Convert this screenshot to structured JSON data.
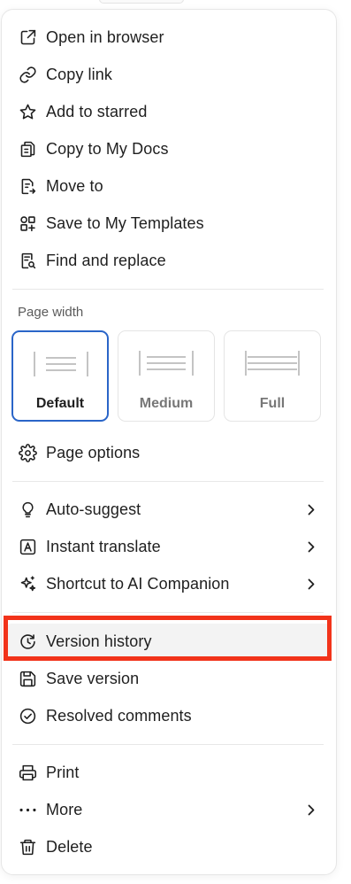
{
  "menu": {
    "group1": [
      {
        "label": "Open in browser",
        "icon": "external-link-icon"
      },
      {
        "label": "Copy link",
        "icon": "link-icon"
      },
      {
        "label": "Add to starred",
        "icon": "star-icon"
      },
      {
        "label": "Copy to My Docs",
        "icon": "copy-docs-icon"
      },
      {
        "label": "Move to",
        "icon": "move-to-icon"
      },
      {
        "label": "Save to My Templates",
        "icon": "templates-icon"
      },
      {
        "label": "Find and replace",
        "icon": "find-replace-icon"
      }
    ],
    "page_width": {
      "title": "Page width",
      "options": [
        {
          "label": "Default",
          "selected": true
        },
        {
          "label": "Medium",
          "selected": false
        },
        {
          "label": "Full",
          "selected": false
        }
      ]
    },
    "page_options": {
      "label": "Page options",
      "icon": "gear-icon"
    },
    "group2": [
      {
        "label": "Auto-suggest",
        "icon": "lightbulb-icon",
        "has_submenu": true
      },
      {
        "label": "Instant translate",
        "icon": "translate-icon",
        "has_submenu": true
      },
      {
        "label": "Shortcut to AI Companion",
        "icon": "sparkle-icon",
        "has_submenu": true
      }
    ],
    "group3": [
      {
        "label": "Version history",
        "icon": "history-icon",
        "highlighted": true
      },
      {
        "label": "Save version",
        "icon": "save-icon"
      },
      {
        "label": "Resolved comments",
        "icon": "check-circle-icon"
      }
    ],
    "group4": [
      {
        "label": "Print",
        "icon": "printer-icon"
      },
      {
        "label": "More",
        "icon": "more-dots-icon",
        "has_submenu": true
      },
      {
        "label": "Delete",
        "icon": "trash-icon"
      }
    ]
  },
  "colors": {
    "selected_border": "#2a65c8",
    "highlight_annotation": "#f2331a",
    "hover_background": "#f3f3f3"
  }
}
